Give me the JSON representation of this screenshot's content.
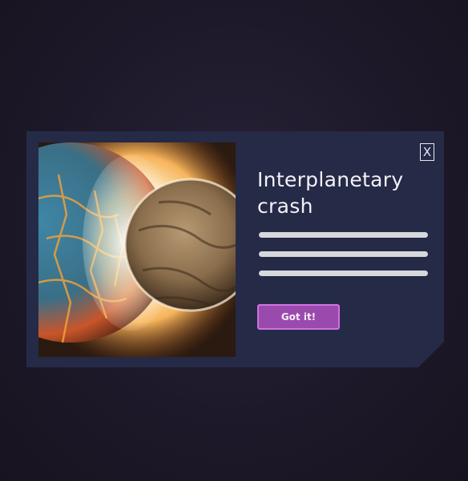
{
  "dialog": {
    "title": "Interplanetary crash",
    "close_label": "X",
    "button_label": "Got it!",
    "text_placeholder_lines": 3,
    "image_subject": "planets-colliding-illustration"
  },
  "colors": {
    "background": "#1f1a2c",
    "panel": "#252a47",
    "text": "#f2f2f6",
    "placeholder_line": "#d7d8dc",
    "button_fill": "#9a4aac",
    "button_border": "#cf73e0"
  }
}
